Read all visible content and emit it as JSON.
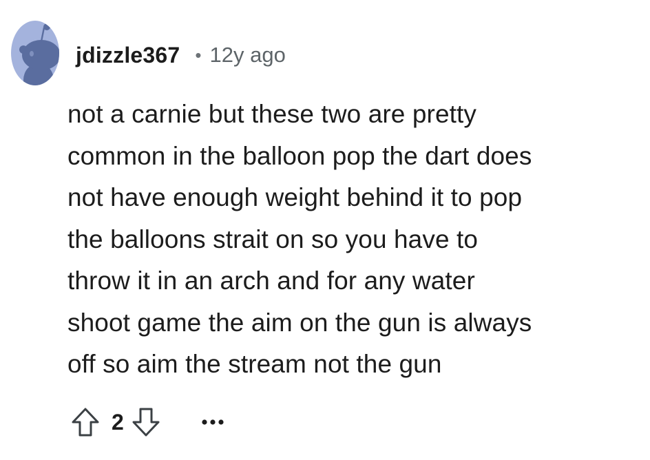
{
  "comment": {
    "username": "jdizzle367",
    "separator": "•",
    "time_ago": "12y ago",
    "body": "not a carnie but these two are pretty\ncommon in the balloon pop the dart does\nnot have enough weight behind it to pop\nthe balloons strait on so you have to\nthrow it in an arch and for any water\nshoot game the aim on the gun is always\noff so aim the stream not the gun",
    "score": "2",
    "upvote_icon": "arrow-up-outline",
    "downvote_icon": "arrow-down-outline",
    "more_icon": "ellipsis-horizontal"
  },
  "colors": {
    "avatar_bg": "#a4b3dd",
    "avatar_figure": "#5a6d9f",
    "text": "#1c1c1c",
    "muted": "#5d6468",
    "icon": "#3b4044"
  }
}
